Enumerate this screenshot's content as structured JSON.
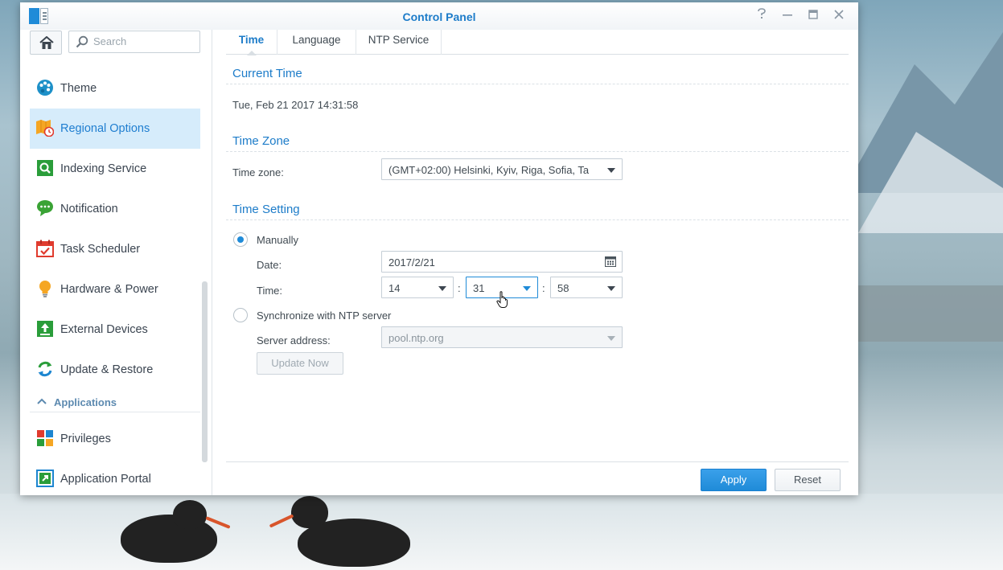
{
  "window": {
    "title": "Control Panel"
  },
  "titlebar": {
    "help_icon": "help-icon",
    "minimize_icon": "minimize-icon",
    "maximize_icon": "maximize-icon",
    "close_icon": "close-icon"
  },
  "sidebar": {
    "search_placeholder": "Search",
    "items": [
      {
        "label": "Theme",
        "icon": "palette-icon",
        "active": false
      },
      {
        "label": "Regional Options",
        "icon": "map-clock-icon",
        "active": true
      },
      {
        "label": "Indexing Service",
        "icon": "indexing-icon",
        "active": false
      },
      {
        "label": "Notification",
        "icon": "chat-bubble-icon",
        "active": false
      },
      {
        "label": "Task Scheduler",
        "icon": "calendar-check-icon",
        "active": false
      },
      {
        "label": "Hardware & Power",
        "icon": "lightbulb-icon",
        "active": false
      },
      {
        "label": "External Devices",
        "icon": "upload-box-icon",
        "active": false
      },
      {
        "label": "Update & Restore",
        "icon": "refresh-icon",
        "active": false
      }
    ],
    "section_applications": "Applications",
    "app_items": [
      {
        "label": "Privileges",
        "icon": "privileges-icon"
      },
      {
        "label": "Application Portal",
        "icon": "portal-icon"
      }
    ]
  },
  "tabs": [
    {
      "label": "Time",
      "active": true
    },
    {
      "label": "Language",
      "active": false
    },
    {
      "label": "NTP Service",
      "active": false
    }
  ],
  "current_time": {
    "heading": "Current Time",
    "value": "Tue, Feb 21 2017 14:31:58"
  },
  "time_zone": {
    "heading": "Time Zone",
    "label": "Time zone:",
    "value": "(GMT+02:00) Helsinki, Kyiv, Riga, Sofia, Ta"
  },
  "time_setting": {
    "heading": "Time Setting",
    "manually_label": "Manually",
    "manually_selected": true,
    "date_label": "Date:",
    "date_value": "2017/2/21",
    "time_label": "Time:",
    "hour": "14",
    "minute": "31",
    "second": "58",
    "separator": ":",
    "ntp_label": "Synchronize with NTP server",
    "ntp_selected": false,
    "server_label": "Server address:",
    "server_value": "pool.ntp.org",
    "update_now": "Update Now"
  },
  "footer": {
    "apply": "Apply",
    "reset": "Reset"
  },
  "colors": {
    "accent": "#1f8bd8",
    "active_bg": "#d6ecfb",
    "title": "#1d7cc9"
  }
}
